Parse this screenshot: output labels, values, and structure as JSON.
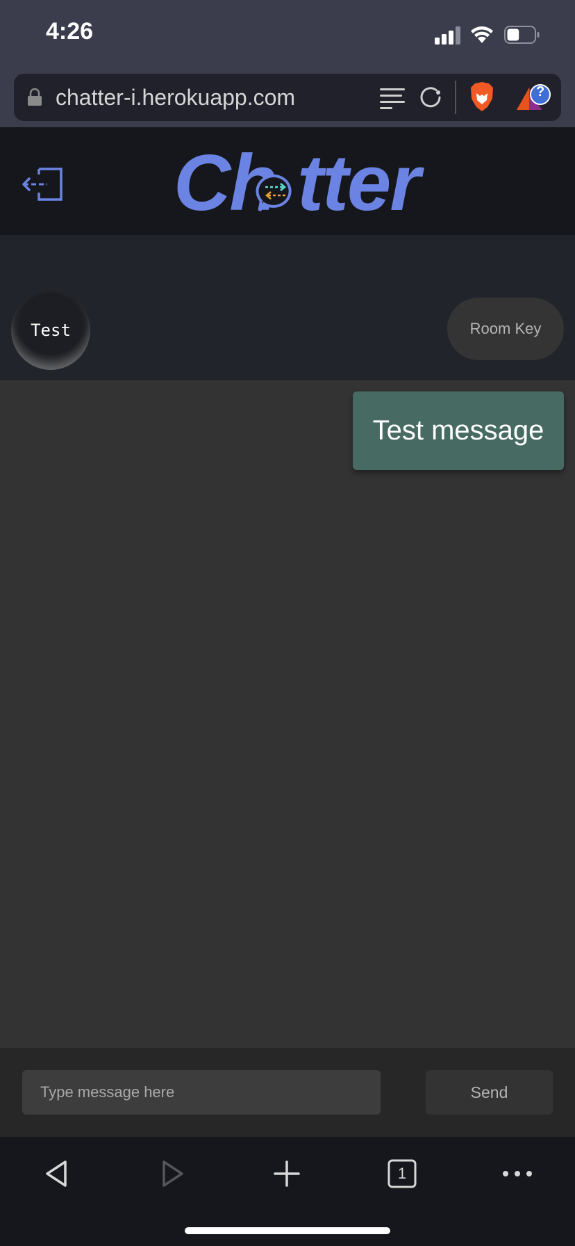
{
  "status_bar": {
    "time": "4:26",
    "signal_icon": "cellular-signal-icon",
    "wifi_icon": "wifi-icon",
    "battery_icon": "battery-icon",
    "battery_level": 0.45
  },
  "browser": {
    "url": "chatter-i.herokuapp.com",
    "icons": [
      "lock-icon",
      "reader-mode-icon",
      "reload-icon",
      "brave-shields-icon",
      "brave-rewards-icon"
    ],
    "rewards_badge": "?"
  },
  "app": {
    "logo": {
      "prefix": "Ch",
      "suffix": "tter"
    },
    "logout_icon": "logout-icon",
    "accent_color": "#6b84e3"
  },
  "room": {
    "name": "Test",
    "room_key_label": "Room Key"
  },
  "messages": [
    {
      "text": "Test message",
      "sender": "self",
      "color": "#476b62"
    }
  ],
  "composer": {
    "placeholder": "Type message here",
    "value": "",
    "send_label": "Send"
  },
  "toolbar": {
    "tab_count": "1",
    "icons": [
      "back-icon",
      "forward-icon",
      "new-tab-icon",
      "tabs-icon",
      "more-icon"
    ]
  }
}
